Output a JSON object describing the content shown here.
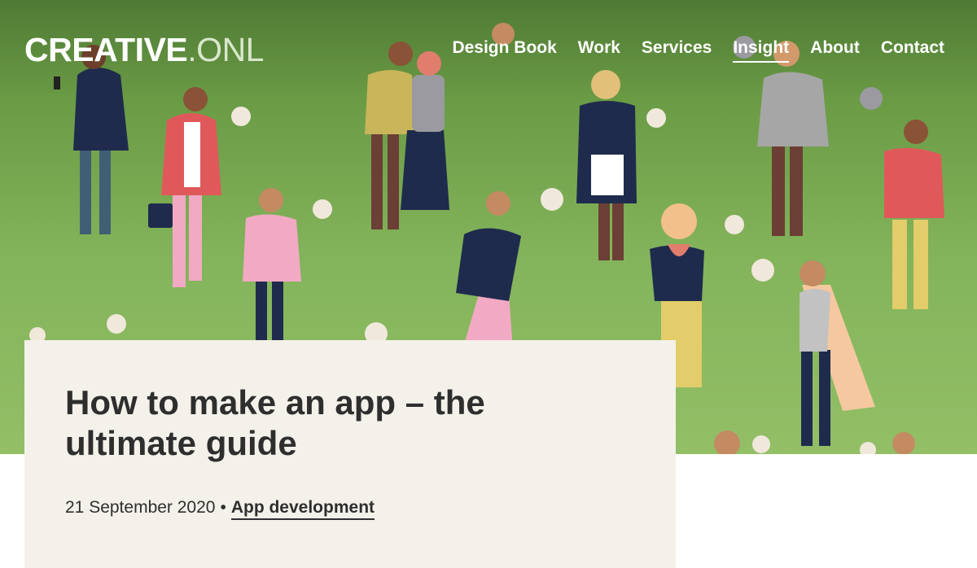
{
  "header": {
    "logo_bold": "CREATIVE",
    "logo_dot": ".",
    "logo_light": "ONL"
  },
  "nav": {
    "items": [
      {
        "label": "Design Book",
        "active": false
      },
      {
        "label": "Work",
        "active": false
      },
      {
        "label": "Services",
        "active": false
      },
      {
        "label": "Insight",
        "active": true
      },
      {
        "label": "About",
        "active": false
      },
      {
        "label": "Contact",
        "active": false
      }
    ]
  },
  "article": {
    "title": "How to make an app – the ultimate guide",
    "date": "21 September 2020",
    "separator": "•",
    "category": "App development"
  },
  "colors": {
    "hero_green": "#82b35a",
    "card_bg": "#f4f1ea",
    "text_dark": "#2e2e2e"
  }
}
